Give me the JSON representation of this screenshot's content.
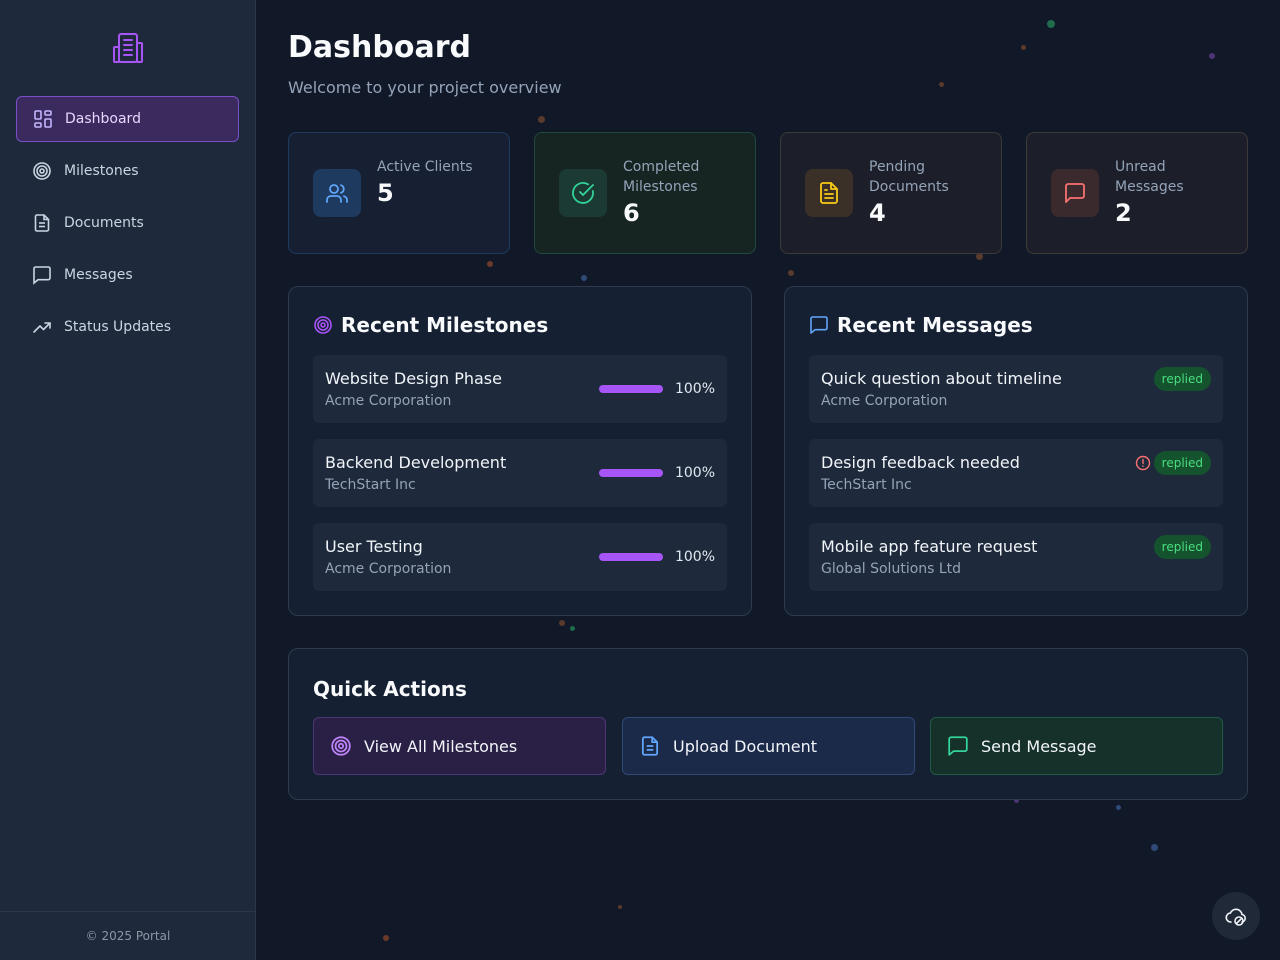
{
  "sidebar": {
    "items": [
      {
        "label": "Dashboard",
        "icon": "layout-grid-icon",
        "active": true
      },
      {
        "label": "Milestones",
        "icon": "target-icon"
      },
      {
        "label": "Documents",
        "icon": "document-icon"
      },
      {
        "label": "Messages",
        "icon": "message-icon"
      },
      {
        "label": "Status Updates",
        "icon": "trending-up-icon"
      }
    ],
    "footer": "© 2025 Portal"
  },
  "header": {
    "title": "Dashboard",
    "subtitle": "Welcome to your project overview"
  },
  "stats": [
    {
      "label": "Active Clients",
      "value": "5",
      "icon": "users-icon",
      "color": "#60a5fa"
    },
    {
      "label": "Completed Milestones",
      "value": "6",
      "icon": "check-circle-icon",
      "color": "#34d399"
    },
    {
      "label": "Pending Documents",
      "value": "4",
      "icon": "document-icon",
      "color": "#facc15"
    },
    {
      "label": "Unread Messages",
      "value": "2",
      "icon": "message-icon",
      "color": "#f87171"
    }
  ],
  "milestones": {
    "title": "Recent Milestones",
    "items": [
      {
        "name": "Website Design Phase",
        "client": "Acme Corporation",
        "progress": "100%",
        "progress_fraction": 1.0
      },
      {
        "name": "Backend Development",
        "client": "TechStart Inc",
        "progress": "100%",
        "progress_fraction": 1.0
      },
      {
        "name": "User Testing",
        "client": "Acme Corporation",
        "progress": "100%",
        "progress_fraction": 1.0
      }
    ]
  },
  "messages": {
    "title": "Recent Messages",
    "items": [
      {
        "subject": "Quick question about timeline",
        "client": "Acme Corporation",
        "status": "replied",
        "alert": false
      },
      {
        "subject": "Design feedback needed",
        "client": "TechStart Inc",
        "status": "replied",
        "alert": true
      },
      {
        "subject": "Mobile app feature request",
        "client": "Global Solutions Ltd",
        "status": "replied",
        "alert": false
      }
    ]
  },
  "quick_actions": {
    "title": "Quick Actions",
    "items": [
      {
        "label": "View All Milestones",
        "icon": "target-icon"
      },
      {
        "label": "Upload Document",
        "icon": "document-icon"
      },
      {
        "label": "Send Message",
        "icon": "message-icon"
      }
    ]
  },
  "colors": {
    "accent": "#a855f7",
    "background": "#111827",
    "sidebar": "#1e293b"
  }
}
